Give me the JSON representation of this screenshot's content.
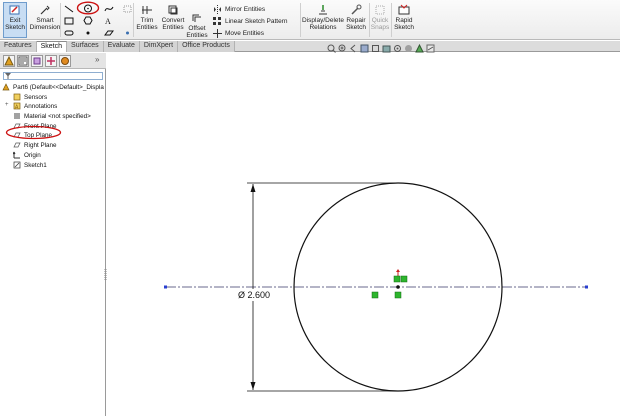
{
  "ribbon": {
    "exit_sketch": "Exit\nSketch",
    "smart_dimension": "Smart\nDimension",
    "trim_entities": "Trim\nEntities",
    "convert_entities": "Convert\nEntities",
    "offset_entities": "Offset\nEntities",
    "mirror_entities": "Mirror Entities",
    "linear_sketch_pattern": "Linear Sketch Pattern",
    "move_entities": "Move Entities",
    "display_delete_relations": "Display/Delete\nRelations",
    "repair_sketch": "Repair\nSketch",
    "quick_snaps": "Quick\nSnaps",
    "rapid_sketch": "Rapid\nSketch"
  },
  "tabs": [
    "Features",
    "Sketch",
    "Surfaces",
    "Evaluate",
    "DimXpert",
    "Office Products"
  ],
  "active_tab": "Sketch",
  "tree": {
    "root": "Part6  (Default<<Default>_Displa",
    "items": [
      {
        "label": "Sensors",
        "icon": "sensor-icon"
      },
      {
        "label": "Annotations",
        "icon": "annotations-icon"
      },
      {
        "label": "Material <not specified>",
        "icon": "material-icon"
      },
      {
        "label": "Front Plane",
        "icon": "plane-icon"
      },
      {
        "label": "Top Plane",
        "icon": "plane-icon"
      },
      {
        "label": "Right Plane",
        "icon": "plane-icon"
      },
      {
        "label": "Origin",
        "icon": "origin-icon"
      },
      {
        "label": "Sketch1",
        "icon": "sketch-icon"
      }
    ]
  },
  "sketch": {
    "dimension_text": "Ø 2.600"
  },
  "colors": {
    "highlight_red": "#cc1111",
    "sketch_black": "#111111",
    "relation_green": "#2db52d",
    "point_blue": "#2a3fd0"
  }
}
